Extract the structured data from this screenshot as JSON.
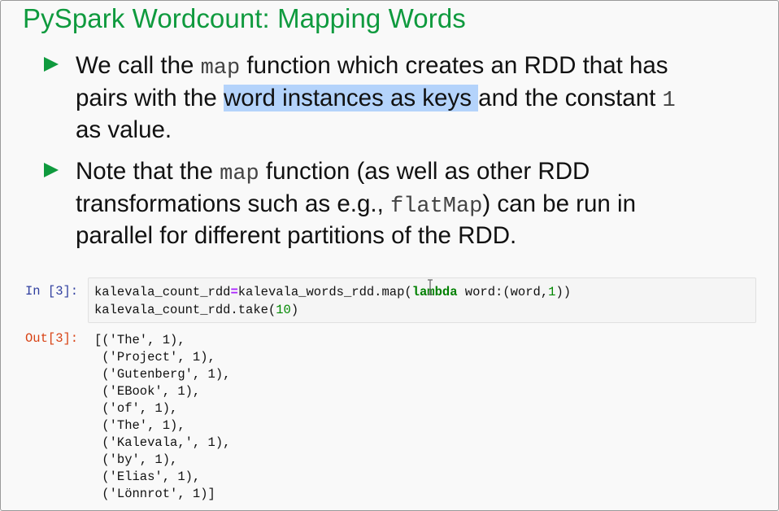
{
  "slide": {
    "title": "PySpark Wordcount: Mapping Words",
    "bullet1": {
      "l1_a": "We call the ",
      "l1_code": "map",
      "l1_b": " function which creates an RDD that has",
      "l2_a": "pairs with the ",
      "l2_highlight": "word instances as keys ",
      "l2_b": "and the constant ",
      "l2_code": "1",
      "l3": "as value."
    },
    "bullet2": {
      "l1_a": "Note that the ",
      "l1_code": "map",
      "l1_b": " function (as well as other RDD",
      "l2_a": "transformations such as e.g., ",
      "l2_code": "flatMap",
      "l2_b": ") can be run in",
      "l3": "parallel for different partitions of the RDD."
    }
  },
  "notebook": {
    "input_prompt": "In [3]:",
    "output_prompt": "Out[3]:",
    "code": {
      "line1_var": "kalevala_count_rdd",
      "line1_eq": "=",
      "line1_call": "kalevala_words_rdd.map(",
      "line1_kw": "lambda",
      "line1_body": " word:(word,",
      "line1_num": "1",
      "line1_end": "))",
      "line2_a": "kalevala_count_rdd.take(",
      "line2_num": "10",
      "line2_end": ")"
    },
    "output_lines": [
      "[('The', 1),",
      " ('Project', 1),",
      " ('Gutenberg', 1),",
      " ('EBook', 1),",
      " ('of', 1),",
      " ('The', 1),",
      " ('Kalevala,', 1),",
      " ('by', 1),",
      " ('Elias', 1),",
      " ('Lönnrot', 1)]"
    ]
  },
  "colors": {
    "title": "#0f9a3e",
    "bullet": "#0f9a3e",
    "highlight": "#b4d3fb",
    "in_prompt": "#303f9f",
    "out_prompt": "#d84315",
    "keyword": "#008000"
  },
  "icons": {
    "bullet": "triangle-bullet-icon",
    "cursor": "text-cursor-icon"
  }
}
